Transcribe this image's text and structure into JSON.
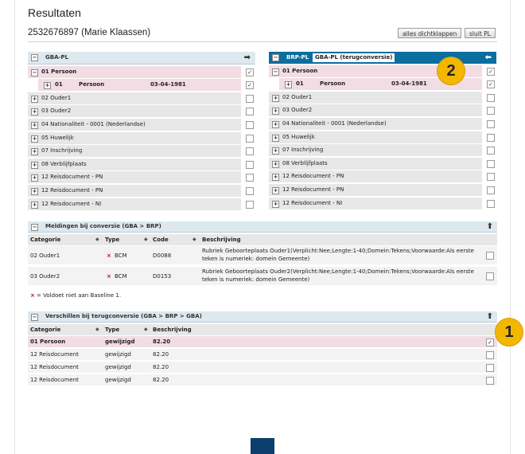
{
  "title": "Resultaten",
  "person": "2532676897 (Marie Klaassen)",
  "buttons": {
    "collapse_all": "alles dichtklappen",
    "close_pl": "sluit PL"
  },
  "gba_panel": {
    "header": "GBA-PL",
    "rows": [
      {
        "label": "01 Persoon",
        "checked": true
      },
      {
        "sub1": "01",
        "sub2": "Persoon",
        "sub3": "03-04-1981",
        "checked": true
      },
      {
        "label": "02 Ouder1",
        "checked": false
      },
      {
        "label": "03 Ouder2",
        "checked": false
      },
      {
        "label": "04 Nationaliteit - 0001 (Nederlandse)",
        "checked": false
      },
      {
        "label": "05 Huwelijk",
        "checked": false
      },
      {
        "label": "07 Inschrijving",
        "checked": false
      },
      {
        "label": "08 Verblijfplaats",
        "checked": false
      },
      {
        "label": "12 Reisdocument - PN",
        "checked": false
      },
      {
        "label": "12 Reisdocument - PN",
        "checked": false
      },
      {
        "label": "12 Reisdocument - NI",
        "checked": false
      }
    ]
  },
  "brp_panel": {
    "header": "BRP-PL",
    "tab": "GBA-PL (terugconversie)",
    "rows": [
      {
        "label": "01 Persoon",
        "checked": true
      },
      {
        "sub1": "01",
        "sub2": "Persoon",
        "sub3": "03-04-1981",
        "checked": true
      },
      {
        "label": "02 Ouder1",
        "checked": false
      },
      {
        "label": "03 Ouder2",
        "checked": false
      },
      {
        "label": "04 Nationaliteit - 0001 (Nederlandse)",
        "checked": false
      },
      {
        "label": "05 Huwelijk",
        "checked": false
      },
      {
        "label": "07 Inschrijving",
        "checked": false
      },
      {
        "label": "08 Verblijfplaats",
        "checked": false
      },
      {
        "label": "12 Reisdocument - PN",
        "checked": false
      },
      {
        "label": "12 Reisdocument - PN",
        "checked": false
      },
      {
        "label": "12 Reisdocument - NI",
        "checked": false
      }
    ]
  },
  "meldingen": {
    "header": "Meldingen bij conversie (GBA > BRP)",
    "columns": [
      "Categorie",
      "Type",
      "Code",
      "Beschrijving"
    ],
    "rows": [
      {
        "cat": "02 Ouder1",
        "type": "BCM",
        "code": "D0088",
        "desc1": "Rubriek Geboorteplaats Ouder1(Verplicht:Nee;Lengte:1-40;Domein:Tekens;Voorwaarde:Als eerste",
        "desc2": "teken is numeriek: domein Gemeente)"
      },
      {
        "cat": "03 Ouder2",
        "type": "BCM",
        "code": "D0153",
        "desc1": "Rubriek Geboorteplaats Ouder2(Verplicht:Nee;Lengte:1-40;Domein:Tekens;Voorwaarde:Als eerste",
        "desc2": "teken is numeriek: domein Gemeente)"
      }
    ],
    "legend": "= Voldoet niet aan Baseline 1."
  },
  "verschillen": {
    "header": "Verschillen bij terugconversie (GBA > BRP > GBA)",
    "columns": [
      "Categorie",
      "Type",
      "Beschrijving"
    ],
    "rows": [
      {
        "cat": "01 Persoon",
        "type": "gewijzigd",
        "desc": "82.20",
        "checked": true
      },
      {
        "cat": "12 Reisdocument",
        "type": "gewijzigd",
        "desc": "82.20",
        "checked": false
      },
      {
        "cat": "12 Reisdocument",
        "type": "gewijzigd",
        "desc": "82.20",
        "checked": false
      },
      {
        "cat": "12 Reisdocument",
        "type": "gewijzigd",
        "desc": "82.20",
        "checked": false
      }
    ]
  },
  "badges": {
    "one": "1",
    "two": "2"
  },
  "icons": {
    "collapse": "minus-box-icon",
    "expand": "plus-box-icon",
    "error": "x-mark-icon",
    "check": "checkmark-icon",
    "arrow_right": "arrow-right-icon",
    "arrow_left": "arrow-left-icon",
    "arrow_up": "arrow-up-icon"
  },
  "colors": {
    "accent": "#0a6ea0",
    "highlight_row": "#f2dde5",
    "badge": "#f3b700",
    "error": "#c0004b"
  }
}
